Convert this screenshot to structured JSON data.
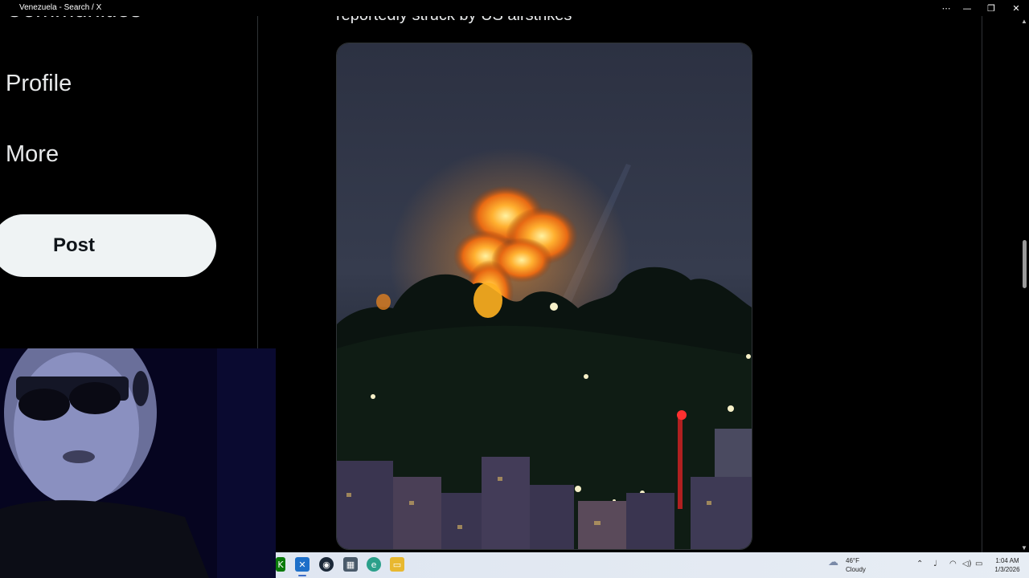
{
  "window": {
    "title": "Venezuela - Search / X",
    "controls": {
      "more": "⋯",
      "minimize": "—",
      "restore": "❐",
      "close": "✕"
    }
  },
  "sidebar": {
    "items": [
      {
        "label": "Communities",
        "icon": "communities-icon"
      },
      {
        "label": "Profile",
        "icon": "profile-icon"
      },
      {
        "label": "More",
        "icon": "more-icon"
      }
    ],
    "post_button": "Post"
  },
  "post": {
    "text": "reportedly struck by US airstrikes",
    "media_alt": "night photo of explosion fireball over hillside city"
  },
  "taskbar": {
    "apps": [
      "terminal-icon",
      "x-app-icon",
      "steam-icon",
      "calculator-icon",
      "edge-icon",
      "file-explorer-icon"
    ],
    "weather": {
      "temp": "46°F",
      "condition": "Cloudy",
      "icon": "cloud-icon"
    },
    "tray": [
      "chevron-up-icon",
      "microphone-icon",
      "wifi-icon",
      "volume-icon",
      "battery-icon"
    ],
    "clock": {
      "time": "1:04 AM",
      "date": "1/3/2026"
    }
  },
  "colors": {
    "background": "#000000",
    "text": "#e7e9ea",
    "post_button_bg": "#eff3f4",
    "divider": "#2f3336"
  }
}
